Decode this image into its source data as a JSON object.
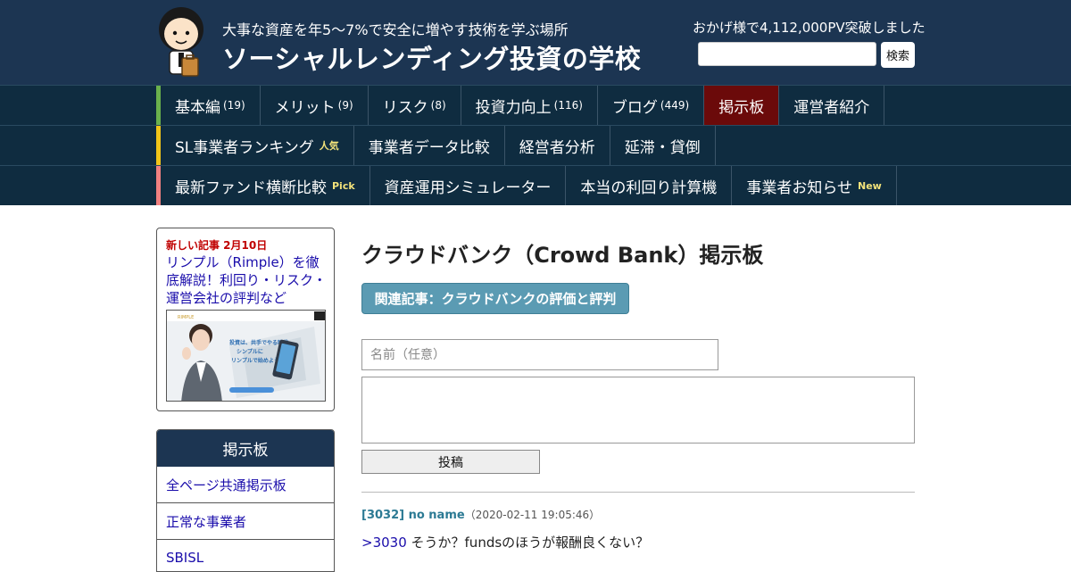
{
  "header": {
    "tagline": "大事な資産を年5～7%で安全に増やす技術を学ぶ場所",
    "site_title": "ソーシャルレンディング投資の学校",
    "pv_notice": "おかげ様で4,112,000PV突破しました",
    "search_label": "検索",
    "bg_color": "#1c3552"
  },
  "nav": {
    "row1": [
      {
        "label": "基本編",
        "count": "(19)"
      },
      {
        "label": "メリット",
        "count": "(9)"
      },
      {
        "label": "リスク",
        "count": "(8)"
      },
      {
        "label": "投資力向上",
        "count": "(116)"
      },
      {
        "label": "ブログ",
        "count": "(449)"
      },
      {
        "label": "掲示板",
        "active": true
      },
      {
        "label": "運営者紹介"
      }
    ],
    "row2": [
      {
        "label": "SL事業者ランキング",
        "badge": "人気"
      },
      {
        "label": "事業者データ比較"
      },
      {
        "label": "経営者分析"
      },
      {
        "label": "延滞・貸倒"
      }
    ],
    "row3": [
      {
        "label": "最新ファンド横断比較",
        "badge": "Pick"
      },
      {
        "label": "資産運用シミュレーター"
      },
      {
        "label": "本当の利回り計算機"
      },
      {
        "label": "事業者お知らせ",
        "badge": "New"
      }
    ],
    "accent_colors": [
      "#6ab04c",
      "#f0c419",
      "#f08080"
    ],
    "active_color": "#6b0a0a"
  },
  "sidebar": {
    "new_post": {
      "label": "新しい記事 2月10日",
      "title": "リンプル（Rimple）を徹底解説！利回り・リスク・運営会社の評判など",
      "thumb_brand": "RIMPLE",
      "thumb_lines": [
        "投資は、共手でやる時代",
        "シンプルに",
        "リンプルで始めよう。"
      ]
    },
    "board": {
      "heading": "掲示板",
      "links": [
        "全ページ共通掲示板",
        "正常な事業者",
        "SBISL"
      ]
    }
  },
  "main": {
    "page_title": "クラウドバンク（Crowd Bank）掲示板",
    "related_button": "関連記事：クラウドバンクの評価と評判",
    "name_placeholder": "名前（任意）",
    "post_button": "投稿",
    "comment": {
      "id_name": "[3032] no name",
      "date": "（2020-02-11 19:05:46）",
      "reply_ref": ">3030",
      "text": "そうか？fundsのほうが報酬良くない？"
    }
  }
}
